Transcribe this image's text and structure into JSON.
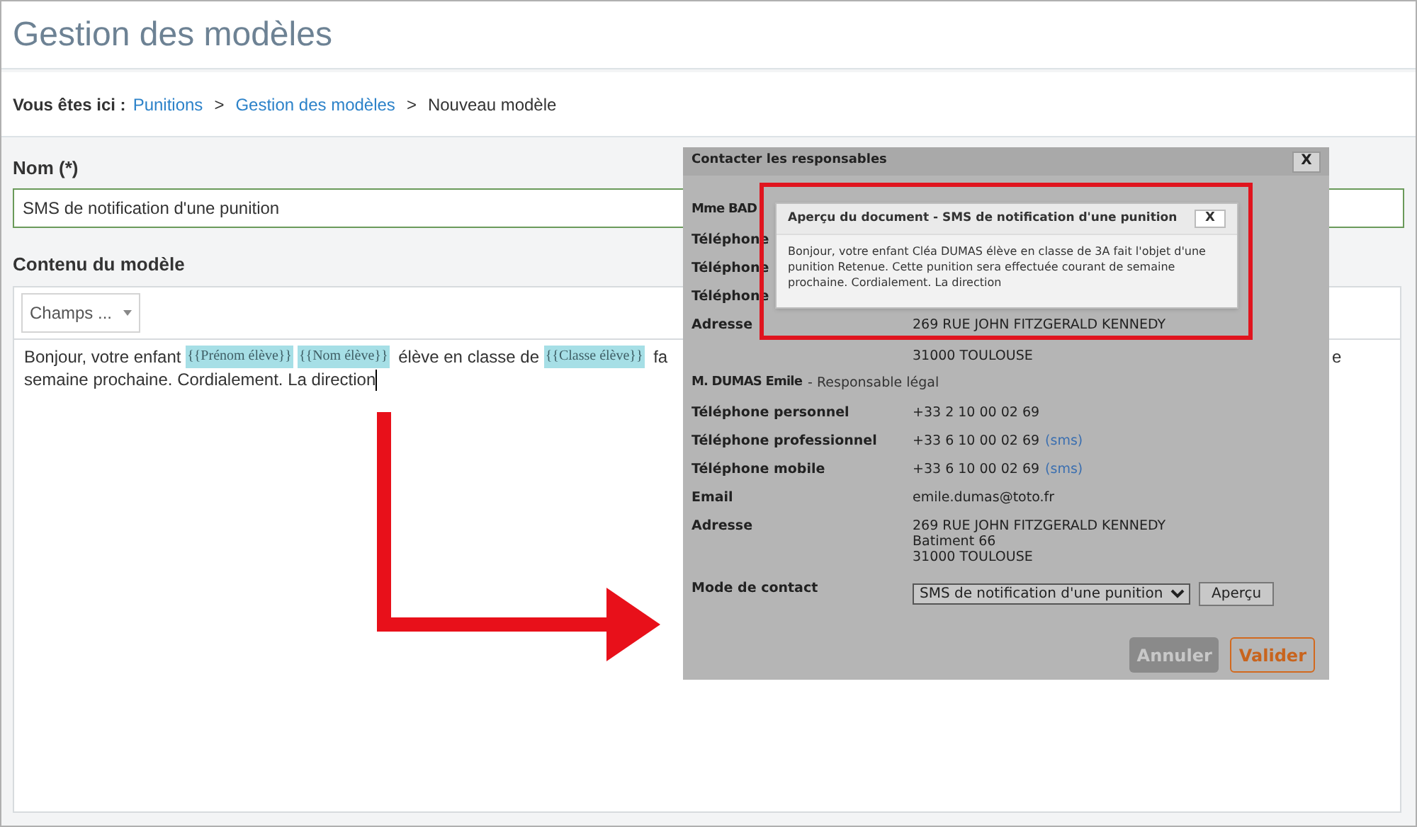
{
  "page_title": "Gestion des modèles",
  "breadcrumb": {
    "prefix": "Vous êtes ici :",
    "items": [
      {
        "label": "Punitions",
        "link": true
      },
      {
        "label": "Gestion des modèles",
        "link": true
      },
      {
        "label": "Nouveau modèle",
        "link": false
      }
    ],
    "separator": ">"
  },
  "name_field": {
    "label": "Nom (*)",
    "value": "SMS de notification d'une punition"
  },
  "content": {
    "label": "Contenu du modèle",
    "fields_button": "Champs ...",
    "lines": [
      [
        {
          "kind": "text",
          "text": "Bonjour, votre enfant "
        },
        {
          "kind": "tag",
          "text": "{{Prénom élève}}"
        },
        {
          "kind": "tag",
          "text": "{{Nom élève}}"
        },
        {
          "kind": "text",
          "text": " élève en classe de "
        },
        {
          "kind": "tag",
          "text": "{{Classe élève}}"
        },
        {
          "kind": "text",
          "text": " fa"
        }
      ],
      [
        {
          "kind": "text",
          "text": "semaine prochaine. Cordialement. La direction"
        }
      ]
    ],
    "right_fragment": "e"
  },
  "dialog": {
    "title": "Contacter les responsables",
    "close": "X",
    "rows": [
      {
        "kind": "heading",
        "label": "Mme BAD"
      },
      {
        "kind": "field",
        "label": "Téléphone"
      },
      {
        "kind": "field",
        "label": "Téléphone"
      },
      {
        "kind": "field",
        "label": "Téléphone"
      },
      {
        "kind": "covered_field",
        "label": "Adresse",
        "value": [
          "269 RUE JOHN FITZGERALD KENNEDY",
          "31000 TOULOUSE"
        ]
      },
      {
        "kind": "heading",
        "label": "M. DUMAS Emile",
        "role": "- Responsable légal"
      },
      {
        "kind": "field",
        "label": "Téléphone personnel",
        "value": [
          "+33 2 10 00 02 69"
        ]
      },
      {
        "kind": "field",
        "label": "Téléphone professionnel",
        "value": [
          "+33 6 10 00 02 69"
        ],
        "sms": "(sms)"
      },
      {
        "kind": "field",
        "label": "Téléphone mobile",
        "value": [
          "+33 6 10 00 02 69"
        ],
        "sms": "(sms)"
      },
      {
        "kind": "field",
        "label": "Email",
        "value": [
          "emile.dumas@toto.fr"
        ]
      },
      {
        "kind": "field",
        "label": "Adresse",
        "value": [
          "269 RUE JOHN FITZGERALD KENNEDY",
          "Batiment 66",
          "31000 TOULOUSE"
        ]
      }
    ],
    "contact_mode": {
      "label": "Mode de contact",
      "value": "SMS de notification d'une punition",
      "preview_button": "Aperçu"
    },
    "buttons": [
      {
        "label": "Annuler",
        "kind": "secondary"
      },
      {
        "label": "Valider",
        "kind": "primary"
      }
    ]
  },
  "preview": {
    "title": "Aperçu du document - SMS de notification d'une punition",
    "close": "X",
    "text": "Bonjour, votre enfant Cléa DUMAS élève en classe de 3A fait l'objet d'une punition Retenue. Cette punition sera effectuée courant de semaine prochaine. Cordialement. La direction"
  }
}
